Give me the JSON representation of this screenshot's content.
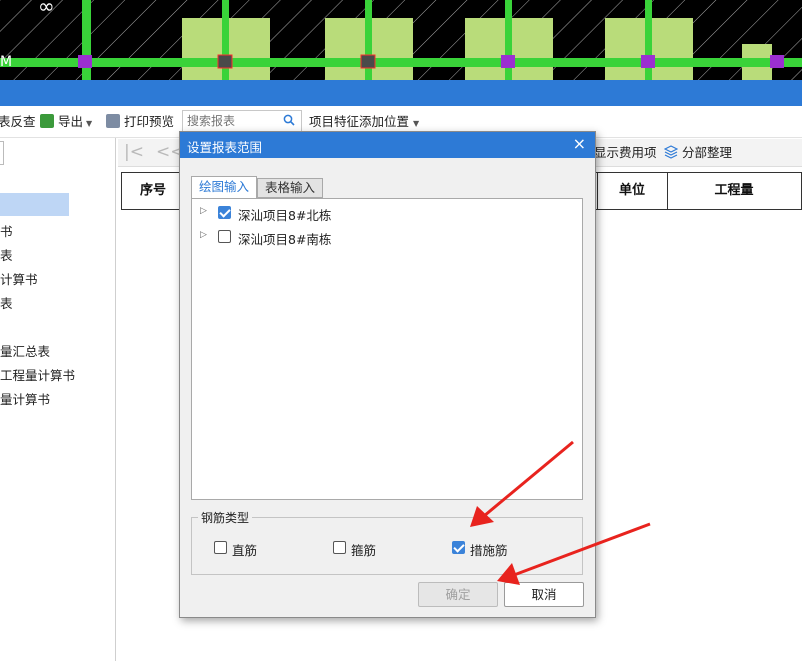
{
  "cad": {
    "labels": [
      "∞",
      "M"
    ]
  },
  "toolbar": {
    "items": [
      {
        "label": "表反查",
        "icon": "reverse-check-icon"
      },
      {
        "label": "导出",
        "icon": "export-icon"
      },
      {
        "label": "打印预览",
        "icon": "print-preview-icon"
      },
      {
        "label": "项目特征添加位置",
        "icon": "chevron-down-icon"
      }
    ],
    "search_placeholder": "搜索报表"
  },
  "left_panel": {
    "items": [
      "书",
      "表",
      "计算书",
      "表",
      "量汇总表",
      "工程量计算书",
      "量计算书"
    ]
  },
  "pager": {
    "first": "|<",
    "prev": "<<"
  },
  "right_tools": {
    "show_fee": "显示费用项",
    "organize": "分部整理"
  },
  "table": {
    "headers": [
      "序号",
      "单位",
      "工程量"
    ]
  },
  "dialog": {
    "title": "设置报表范围",
    "close": "×",
    "tabs": [
      "绘图输入",
      "表格输入"
    ],
    "tree": [
      {
        "label": "深汕项目8#北栋",
        "checked": true
      },
      {
        "label": "深汕项目8#南栋",
        "checked": false
      }
    ],
    "group_label": "钢筋类型",
    "options": [
      {
        "label": "直筋",
        "checked": false
      },
      {
        "label": "箍筋",
        "checked": false
      },
      {
        "label": "措施筋",
        "checked": true
      }
    ],
    "ok": "确定",
    "cancel": "取消"
  },
  "colors": {
    "accent": "#2d7ad6",
    "annotation_red": "#e8231e",
    "cad_green": "#39d339",
    "cad_fill": "#b9dc7a"
  }
}
